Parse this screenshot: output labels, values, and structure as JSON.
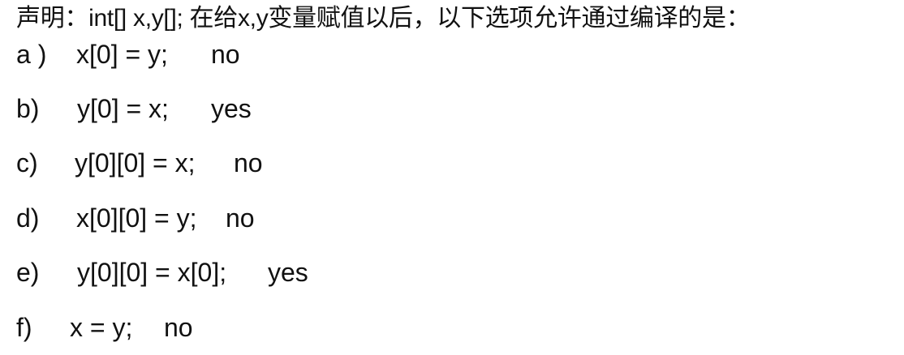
{
  "question": "声明：int[] x,y[]; 在给x,y变量赋值以后，以下选项允许通过编译的是：",
  "options": [
    {
      "letter": "a )",
      "expression": "x[0] = y;",
      "answer": "no"
    },
    {
      "letter": "b)",
      "expression": "y[0] = x;",
      "answer": "yes"
    },
    {
      "letter": "c)",
      "expression": "y[0][0] = x;",
      "answer": "no"
    },
    {
      "letter": "d)",
      "expression": "x[0][0] = y;",
      "answer": "no"
    },
    {
      "letter": "e)",
      "expression": "y[0][0] = x[0];",
      "answer": "yes"
    },
    {
      "letter": "f)",
      "expression": "x = y;",
      "answer": "no"
    }
  ]
}
